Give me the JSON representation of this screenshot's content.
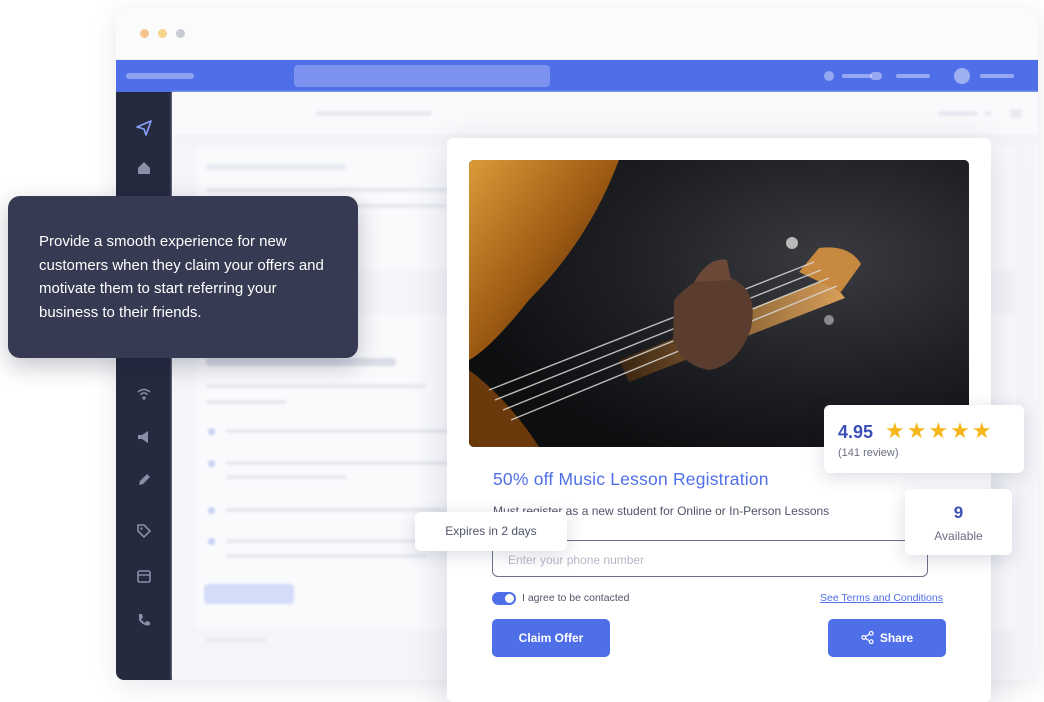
{
  "tooltip": {
    "text": "Provide a smooth experience for new customers when they claim your offers and motivate them to start referring your business to their friends."
  },
  "offer": {
    "title": "50% off Music Lesson Registration",
    "description": "Must register as a new student for Online or In-Person Lessons",
    "phone_placeholder": "Enter your phone number",
    "consent_label": "I agree to be contacted",
    "consent_checked": true,
    "terms_link": "See Terms and Conditions",
    "claim_button": "Claim Offer",
    "share_button": "Share"
  },
  "rating": {
    "value": "4.95",
    "stars": "★★★★★",
    "reviews": "(141 review)"
  },
  "expiry": {
    "text": "Expires in 2 days"
  },
  "availability": {
    "count": "9",
    "label": "Available"
  },
  "icons": {
    "sidebar": [
      "send-icon",
      "home-icon",
      "wifi-icon",
      "megaphone-icon",
      "pen-icon",
      "tag-icon",
      "calendar-icon",
      "phone-icon"
    ],
    "share": "share-icon"
  },
  "colors": {
    "accent": "#4f6fe8",
    "sidebar": "#262a3f",
    "tooltip": "#363a52",
    "star": "#f6b71c"
  }
}
